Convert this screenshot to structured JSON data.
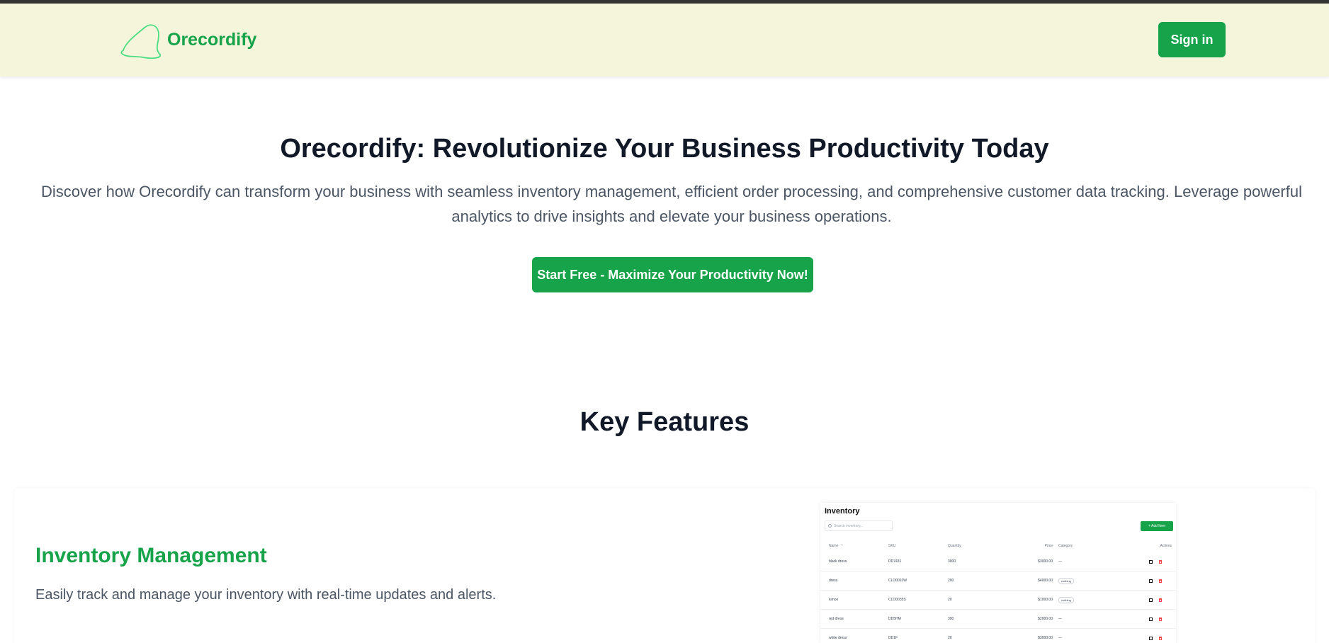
{
  "brand": {
    "name": "Orecordify",
    "color": "#16a34a"
  },
  "header": {
    "signin_label": "Sign in"
  },
  "hero": {
    "title": "Orecordify: Revolutionize Your Business Productivity Today",
    "description": "Discover how Orecordify can transform your business with seamless inventory management, efficient order processing, and comprehensive customer data tracking. Leverage powerful analytics to drive insights and elevate your business operations.",
    "cta_label": "Start Free - Maximize Your Productivity Now!"
  },
  "features": {
    "title": "Key Features",
    "items": [
      {
        "title": "Inventory Management",
        "description": "Easily track and manage your inventory with real-time updates and alerts."
      }
    ]
  },
  "inventory_preview": {
    "title": "Inventory",
    "search_placeholder": "Search inventory...",
    "add_label": "+ Add Item",
    "columns": [
      "Name",
      "SKU",
      "Quantity",
      "Price",
      "Category",
      "Actions"
    ],
    "rows": [
      {
        "name": "black dress",
        "sku": "DD7431",
        "qty": "3000",
        "price": "$3000.00",
        "category": "—"
      },
      {
        "name": "dress",
        "sku": "CLO0010W",
        "qty": "200",
        "price": "$4000.00",
        "category": "clothing"
      },
      {
        "name": "kimoo",
        "sku": "CLO0035S",
        "qty": "20",
        "price": "$1000.00",
        "category": "clothing"
      },
      {
        "name": "red dress",
        "sku": "DD5HM",
        "qty": "300",
        "price": "$2000.00",
        "category": "—"
      },
      {
        "name": "white dress",
        "sku": "DD1F",
        "qty": "20",
        "price": "$3000.00",
        "category": "—"
      }
    ]
  }
}
